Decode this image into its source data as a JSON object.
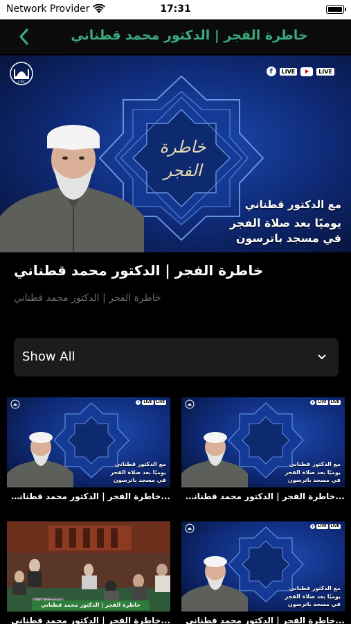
{
  "status_bar": {
    "carrier": "Network Provider",
    "time": "17:31"
  },
  "nav": {
    "title": "خاطرة الفجر | الدكتور محمد قطناني",
    "accent_color": "#3aa97e",
    "back_icon": "chevron-left-icon"
  },
  "hero": {
    "calligraphy_line1": "خاطرة",
    "calligraphy_line2": "الفجر",
    "caption_line1": "مع الدكتور قطناني",
    "caption_line2": "يوميًا بعد صلاة الفجر",
    "caption_line3": "في مسجد باترسون",
    "badges": [
      {
        "icon": "facebook-icon",
        "label": "LIVE"
      },
      {
        "icon": "youtube-icon",
        "label": "LIVE"
      }
    ],
    "logo_text": "CPC",
    "facebook_glyph": "f"
  },
  "video": {
    "title": "خاطرة الفجر | الدكتور محمد قطناني",
    "subtitle": "خاطرة الفجر | الدكتور محمد قطناني"
  },
  "filter": {
    "selected": "Show All",
    "icon": "chevron-down-icon"
  },
  "grid": [
    {
      "title": "...خاطرة الفجر | الدكتور محمد  قطناني | ا",
      "kind": "promo"
    },
    {
      "title": "...خاطرة الفجر | الدكتور محمد  قطناني | ا",
      "kind": "promo"
    },
    {
      "title": "...خاطرة الفجر | الدكتور محمد  قطناني",
      "kind": "mosque",
      "overlay_label": "CPC-Paterson",
      "overlay_bar": "خاطرة الفجر | الدكتور محمد قطناني"
    },
    {
      "title": "...خاطرة الفجر | الدكتور محمد  قطناني",
      "kind": "promo"
    }
  ]
}
